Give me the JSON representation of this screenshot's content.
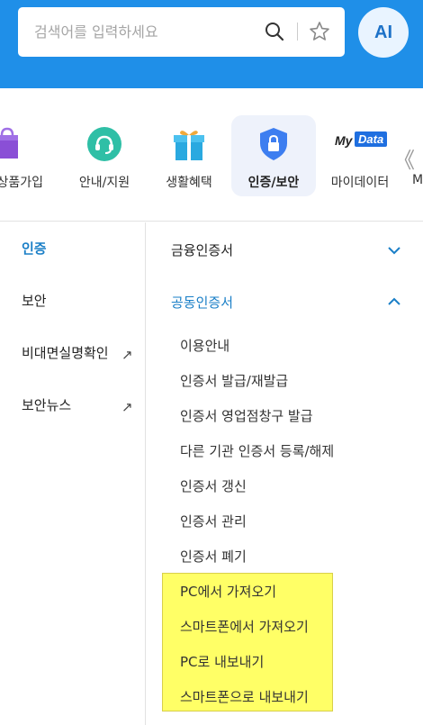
{
  "search": {
    "placeholder": "검색어를 입력하세요",
    "search_icon": "search-icon",
    "star_icon": "star-icon"
  },
  "ai_badge": "AI",
  "tabs": [
    {
      "label": "상품가입",
      "icon": "shopping-bag-icon",
      "color": "#8a4fd6"
    },
    {
      "label": "안내/지원",
      "icon": "headset-icon",
      "color": "#2fbfa6"
    },
    {
      "label": "생활혜택",
      "icon": "gift-icon",
      "color": "#2aa9e0"
    },
    {
      "label": "인증/보안",
      "icon": "shield-lock-icon",
      "color": "#3d7ef0",
      "active": true
    },
    {
      "label": "마이데이터",
      "icon": "mydata-logo",
      "logo_text_1": "My",
      "logo_text_2": "Data"
    },
    {
      "label": "M",
      "partial": true
    }
  ],
  "scroll_arrows": "《",
  "left_menu": [
    {
      "label": "인증",
      "active": true
    },
    {
      "label": "보안"
    },
    {
      "label": "비대면실명확인",
      "external": "↗"
    },
    {
      "label": "보안뉴스",
      "external": "↗"
    }
  ],
  "right": {
    "sections": [
      {
        "title": "금융인증서",
        "expanded": false
      },
      {
        "title": "공동인증서",
        "expanded": true
      }
    ],
    "sub_items": [
      "이용안내",
      "인증서 발급/재발급",
      "인증서 영업점창구 발급",
      "다른 기관 인증서 등록/해제",
      "인증서 갱신",
      "인증서 관리",
      "인증서 폐기",
      "PC에서 가져오기",
      "스마트폰에서 가져오기",
      "PC로 내보내기",
      "스마트폰으로 내보내기"
    ]
  },
  "colors": {
    "header_bg": "#1f8fe8",
    "accent": "#1a7fc7",
    "highlight": "#ffff66"
  }
}
